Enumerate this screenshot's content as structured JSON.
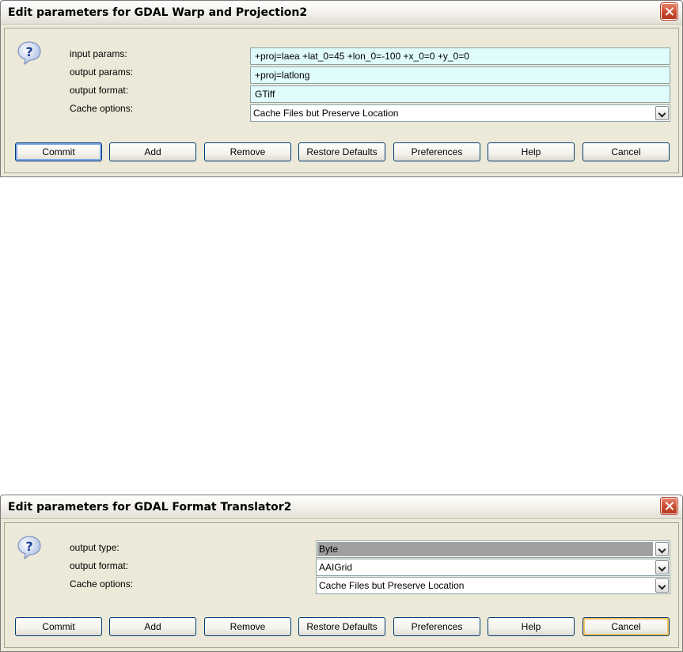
{
  "dialog1": {
    "title": "Edit parameters for GDAL Warp and Projection2",
    "fields": [
      {
        "label": "input params:",
        "value": "+proj=laea +lat_0=45 +lon_0=-100 +x_0=0 +y_0=0"
      },
      {
        "label": "output params:",
        "value": "+proj=latlong"
      },
      {
        "label": "output format:",
        "value": "GTiff"
      },
      {
        "label": "Cache options:",
        "value": "Cache Files but Preserve Location"
      }
    ],
    "buttons": [
      "Commit",
      "Add",
      "Remove",
      "Restore Defaults",
      "Preferences",
      "Help",
      "Cancel"
    ]
  },
  "dialog2": {
    "title": "Edit parameters for GDAL Format Translator2",
    "fields": [
      {
        "label": "output type:",
        "value": "Byte"
      },
      {
        "label": "output format:",
        "value": "AAIGrid"
      },
      {
        "label": "Cache options:",
        "value": "Cache Files but Preserve Location"
      }
    ],
    "buttons": [
      "Commit",
      "Add",
      "Remove",
      "Restore Defaults",
      "Preferences",
      "Help",
      "Cancel"
    ]
  },
  "icons": {
    "help": "question-icon",
    "close": "close-icon",
    "dropdown": "chevron-down-icon"
  },
  "colors": {
    "field_bg": "#e0fbfc",
    "dialog_bg": "#ece9d8",
    "close_red": "#c94a2f",
    "focus_blue": "#7ea5e8",
    "hot_orange": "#f5c35e"
  }
}
